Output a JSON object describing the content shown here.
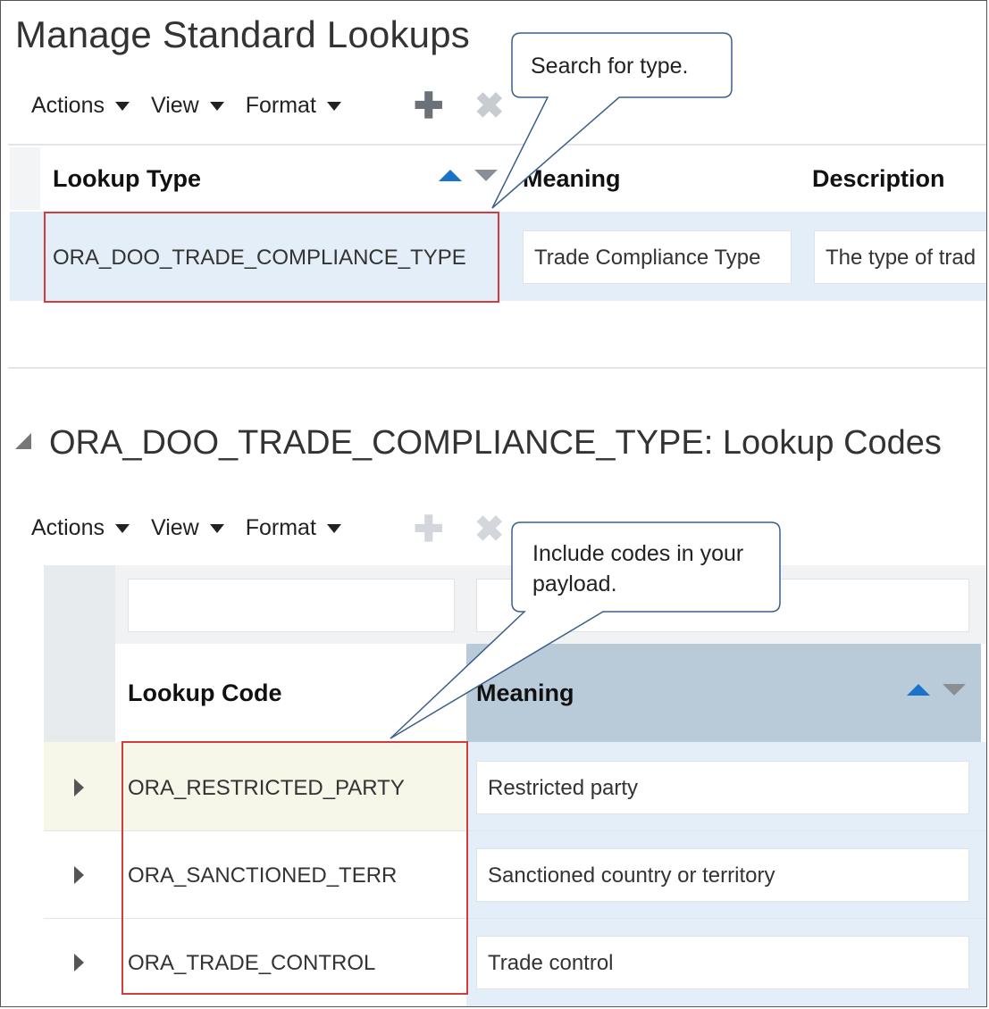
{
  "page": {
    "title": "Manage Standard Lookups"
  },
  "toolbar1": {
    "actions": "Actions",
    "view": "View",
    "format": "Format"
  },
  "lookup_types": {
    "columns": [
      "Lookup Type",
      "Meaning",
      "Description"
    ],
    "row": {
      "lookup_type": "ORA_DOO_TRADE_COMPLIANCE_TYPE",
      "meaning": "Trade Compliance Type",
      "description": "The type of trad"
    }
  },
  "callouts": {
    "top": "Search for type.",
    "bottom": "Include codes in your payload."
  },
  "codes_section": {
    "title": "ORA_DOO_TRADE_COMPLIANCE_TYPE: Lookup Codes"
  },
  "toolbar2": {
    "actions": "Actions",
    "view": "View",
    "format": "Format"
  },
  "lookup_codes": {
    "columns": [
      "Lookup Code",
      "Meaning"
    ],
    "rows": [
      {
        "code": "ORA_RESTRICTED_PARTY",
        "meaning": "Restricted party"
      },
      {
        "code": "ORA_SANCTIONED_TERR",
        "meaning": "Sanctioned country or territory"
      },
      {
        "code": "ORA_TRADE_CONTROL",
        "meaning": "Trade control"
      }
    ]
  },
  "colors": {
    "selected_row": "#e3eef9",
    "highlight_row": "#f6f7e8",
    "sorted_header": "#b9cad9",
    "sort_active": "#1a73c9",
    "annotation_red": "#d33c3c",
    "callout_border": "#3a5f8a"
  },
  "icons": [
    "caret-down-icon",
    "add-icon",
    "delete-icon",
    "sort-ascending-icon",
    "sort-descending-icon",
    "collapse-icon",
    "expand-row-icon"
  ]
}
